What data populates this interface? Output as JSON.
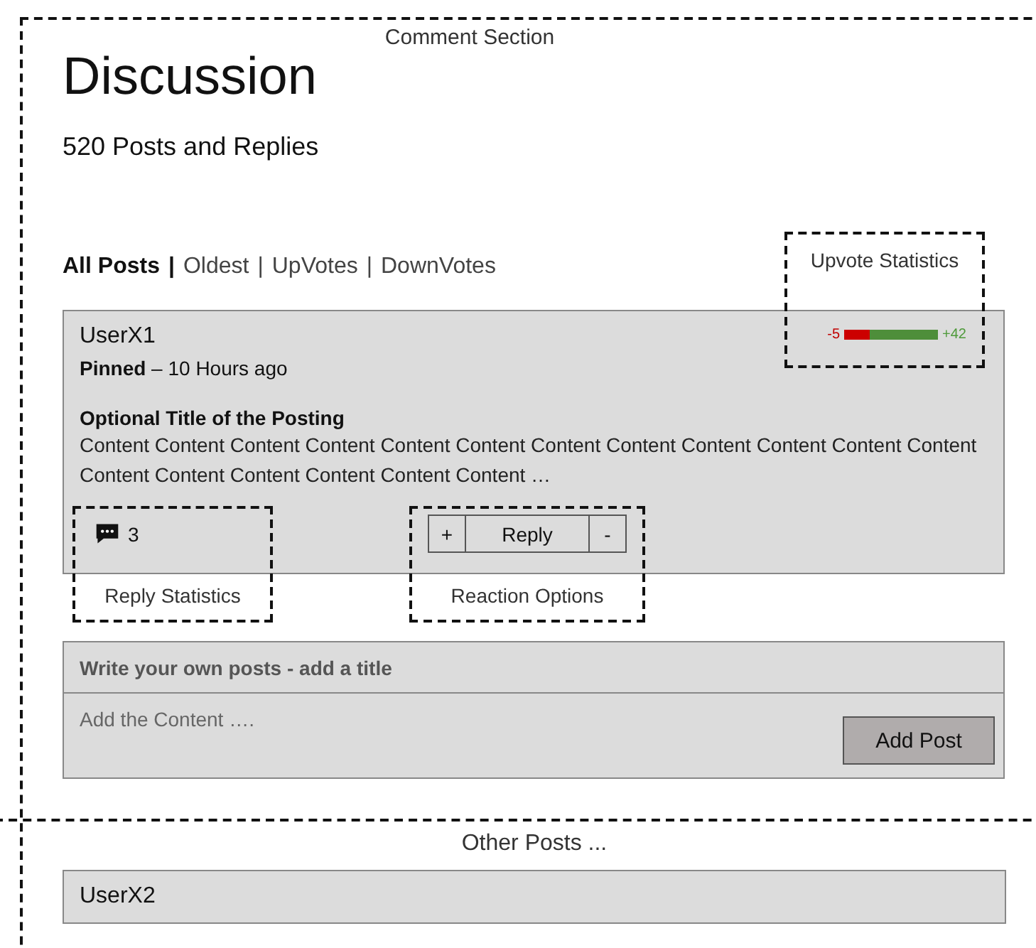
{
  "comment_section": {
    "label": "Comment Section",
    "title": "Discussion",
    "count": "520 Posts and Replies",
    "sort_tabs": [
      {
        "label": "All Posts",
        "selected": true,
        "separator": "|"
      },
      {
        "label": "Oldest",
        "selected": false,
        "separator": "|"
      },
      {
        "label": "UpVotes",
        "selected": false,
        "separator": "|"
      },
      {
        "label": "DownVotes",
        "selected": false
      }
    ],
    "post": {
      "user": "UserX1",
      "status": "Pinned",
      "time": "– 10 Hours ago",
      "title": "Optional Title of the Posting",
      "content": "Content Content Content Content Content Content Content Content Content Content Content Content Content Content Content Content Content Content …",
      "votes": {
        "down": "-5",
        "up": "+42",
        "level": 0.27
      },
      "reply_count": "3",
      "actions": [
        {
          "label": "+"
        },
        {
          "label": "Reply"
        },
        {
          "label": "-"
        }
      ]
    },
    "compose": {
      "title_placeholder": "Write your own posts - add a title",
      "content_placeholder": "Add the Content ….",
      "button": "Add Post"
    },
    "annotations": [
      {
        "label": "Upvote Statistics"
      },
      {
        "label": "Reply Statistics"
      },
      {
        "label": "Reaction Options"
      }
    ]
  },
  "other_section": {
    "label": "Other Posts ...",
    "posts": [
      {
        "user": "UserX2"
      }
    ]
  }
}
